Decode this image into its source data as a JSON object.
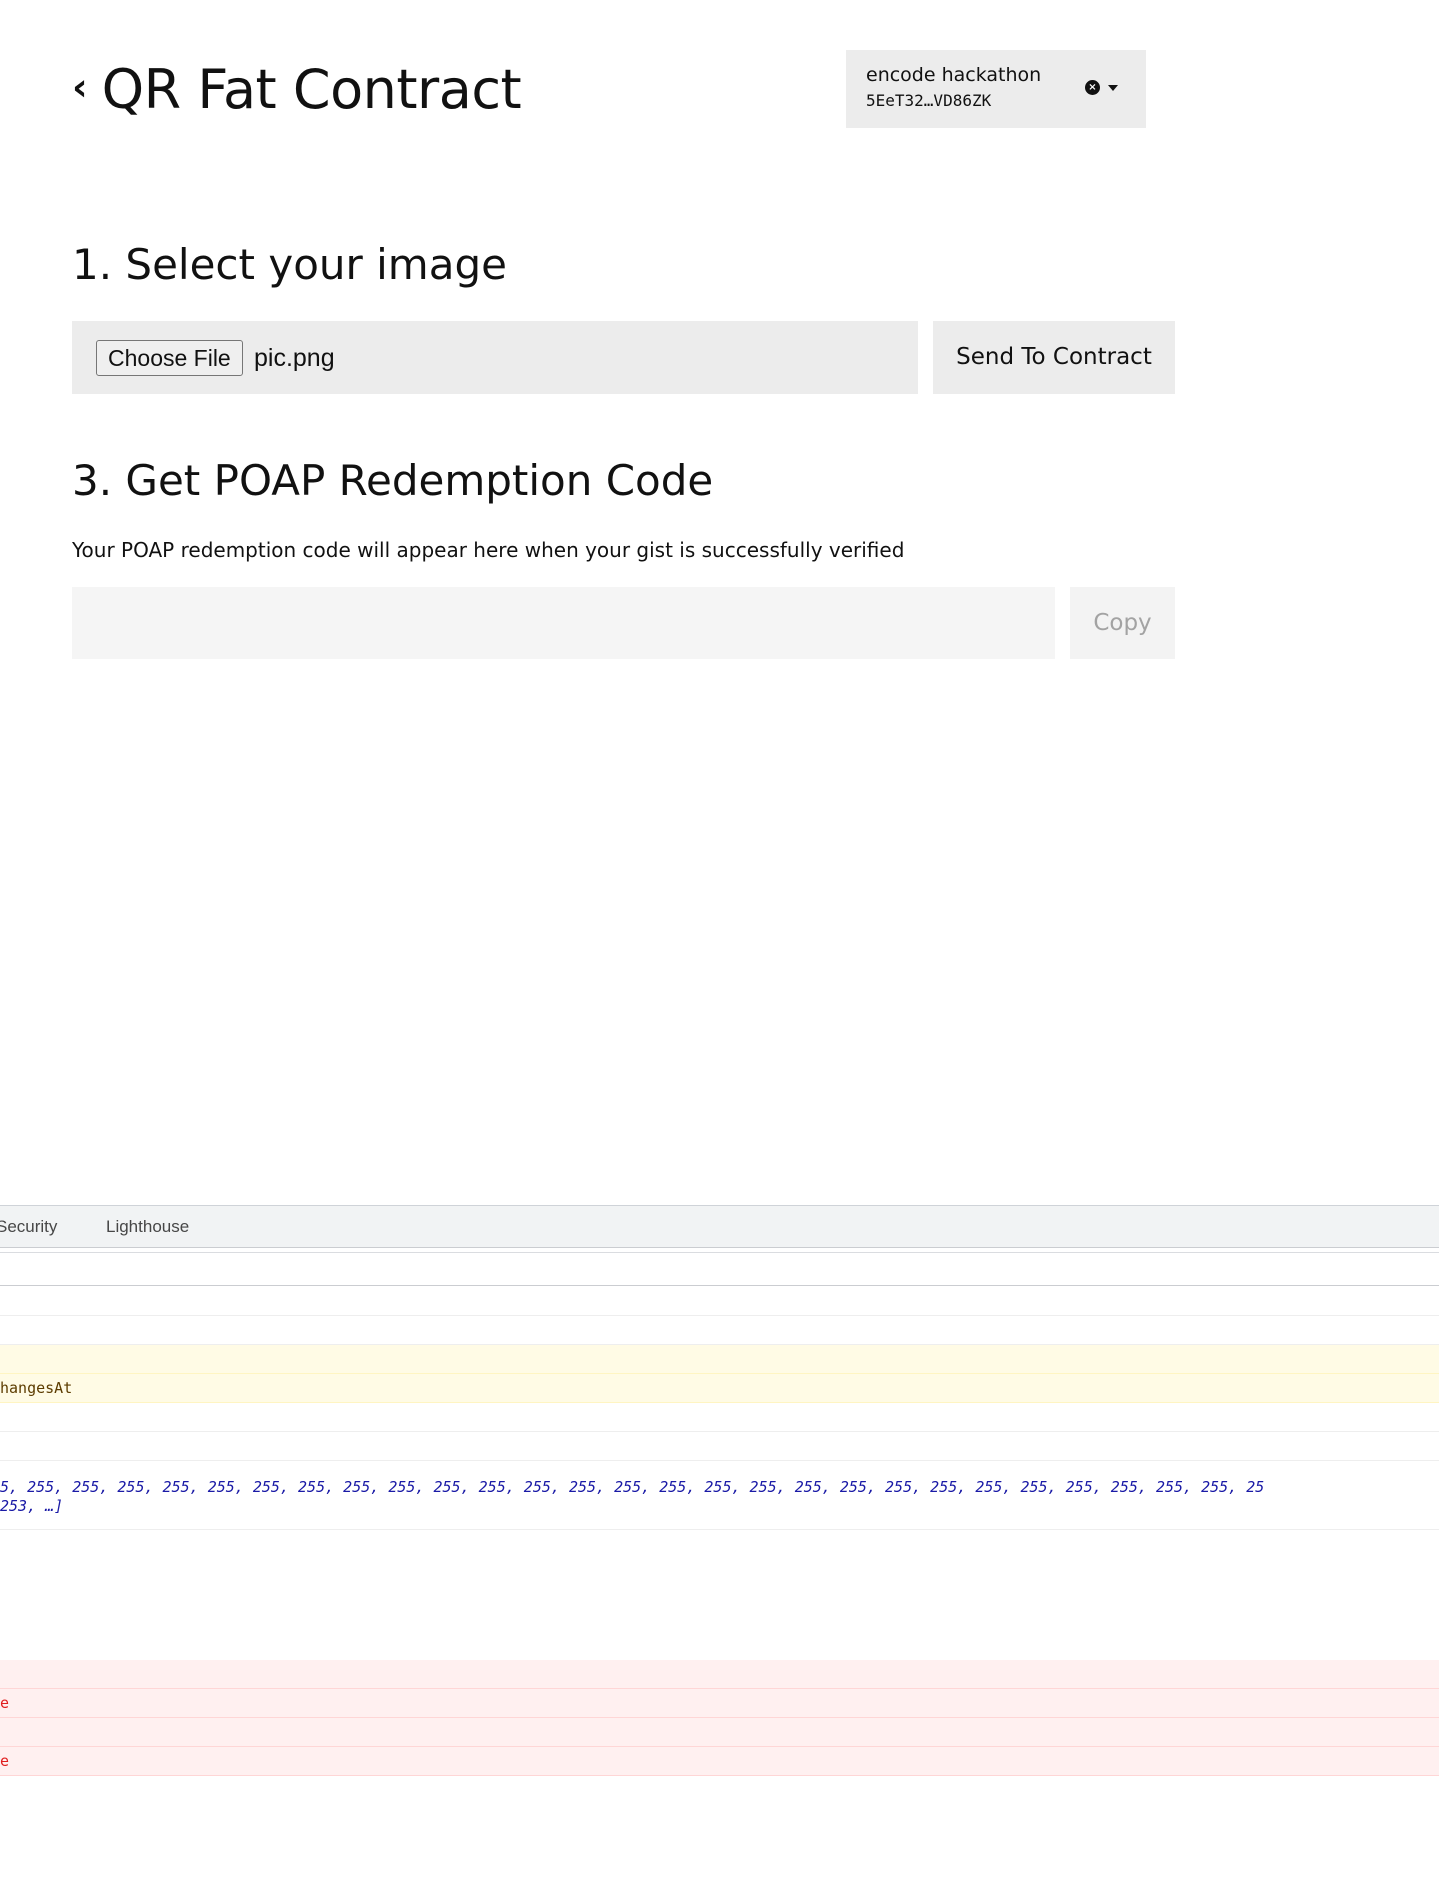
{
  "header": {
    "back_icon": "chevron-left-icon",
    "back_glyph": "‹",
    "title": "QR Fat Contract"
  },
  "account": {
    "name": "encode hackathon",
    "address": "5EeT32…VD86ZK",
    "clear_glyph": "×"
  },
  "step1": {
    "title": "1. Select your image",
    "choose_file_label": "Choose File",
    "file_name": "pic.png",
    "send_label": "Send To Contract"
  },
  "step3": {
    "title": "3. Get POAP Redemption Code",
    "description": "Your POAP redemption code will appear here when your gist is successfully verified",
    "code_value": "",
    "copy_label": "Copy"
  },
  "devtools": {
    "tabs": [
      "Security",
      "Lighthouse"
    ],
    "console": {
      "warning_text": "hangesAt",
      "array_line_1": "5, 255, 255, 255, 255, 255, 255, 255, 255, 255, 255, 255, 255, 255, 255, 255, 255, 255, 255, 255, 255, 255, 255, 255, 255, 255, 255, 255, 25",
      "array_line_2": "253, …]",
      "error_text_1": "e",
      "error_text_2": "e"
    }
  }
}
